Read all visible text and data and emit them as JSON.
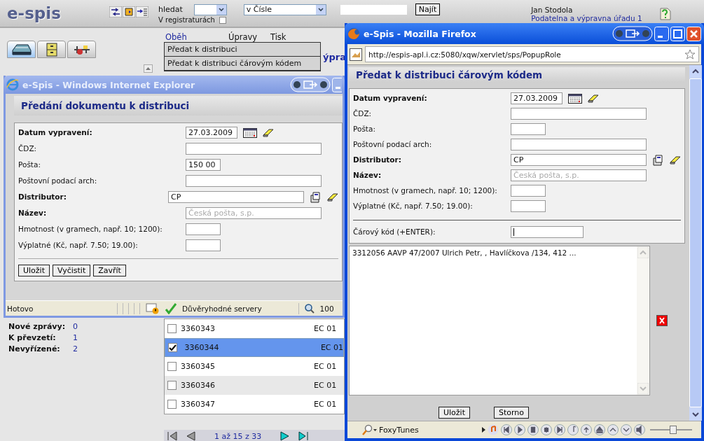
{
  "app": {
    "logo": "e-spis",
    "search_label": "hledat",
    "search_field": "v Čísle",
    "registry_label": "V registraturách",
    "registry_checked": false,
    "find_button": "Najít",
    "user_name": "Jan Stodola",
    "user_office": "Podatelna a výpravna úřadu 1",
    "nav_tabs": [
      {
        "selected": true
      },
      {
        "selected": false
      },
      {
        "selected": false
      }
    ],
    "menu": [
      {
        "label": "Oběh",
        "selected": true
      },
      {
        "label": "Úpravy",
        "selected": false
      },
      {
        "label": "Tisk",
        "selected": false
      }
    ],
    "menu_items": [
      "Předat k distribuci",
      "Předat k distribuci čárovým kódem"
    ],
    "heading_fragment": "ýpra",
    "stats": [
      {
        "label": "Nové zprávy:",
        "value": "0"
      },
      {
        "label": "K převzetí:",
        "value": "1"
      },
      {
        "label": "Nevyřízené:",
        "value": "2"
      }
    ],
    "rows": [
      {
        "number": "3360343",
        "column_2": "EC 01",
        "checked": false,
        "selected": false
      },
      {
        "number": "3360344",
        "column_2": "EC 01",
        "checked": true,
        "selected": true
      },
      {
        "number": "3360345",
        "column_2": "EC 01",
        "checked": false,
        "selected": false
      },
      {
        "number": "3360346",
        "column_2": "EC 01",
        "checked": false,
        "selected": false
      },
      {
        "number": "3360347",
        "column_2": "EC 01",
        "checked": false,
        "selected": false
      }
    ],
    "pager": "1 až 15 z 33"
  },
  "ie_window": {
    "title": "e-Spis - Windows Internet Explorer",
    "heading": "Předání dokumentu k distribuci",
    "fields": [
      {
        "label": "Datum vypravení:",
        "required": true,
        "kind": "date",
        "value": "27.03.2009"
      },
      {
        "label": "ČDZ:",
        "required": false,
        "kind": "wide"
      },
      {
        "label": "Pošta:",
        "required": false,
        "kind": "short",
        "value": "150 00"
      },
      {
        "label": "Poštovní podací arch:",
        "required": false,
        "kind": "wide"
      },
      {
        "label": "Distributor:",
        "required": true,
        "kind": "lookup",
        "value": "CP"
      },
      {
        "label": "Název:",
        "required": true,
        "kind": "readonly",
        "value": "Česká pošta, s.p."
      },
      {
        "label": "Hmotnost (v gramech, např. 10; 1200):",
        "required": false,
        "kind": "short"
      },
      {
        "label": "Výplatné (Kč, např. 7.50; 19.00):",
        "required": false,
        "kind": "short"
      }
    ],
    "buttons": [
      "Uložit",
      "Vyčistit",
      "Zavřít"
    ],
    "status": "Hotovo",
    "zone": "Důvěryhodné servery",
    "zoom": "100"
  },
  "firefox_window": {
    "title": "e-Spis - Mozilla Firefox",
    "url": "http://espis-apl.i.cz:5080/xqw/xervlet/sps/PopupRole",
    "heading": "Předat k distribuci čárovým kódem",
    "fields": [
      {
        "label": "Datum vypravení:",
        "required": true,
        "kind": "date",
        "value": "27.03.2009"
      },
      {
        "label": "ČDZ:",
        "required": false,
        "kind": "wide"
      },
      {
        "label": "Pošta:",
        "required": false,
        "kind": "short"
      },
      {
        "label": "Poštovní podací arch:",
        "required": false,
        "kind": "wide"
      },
      {
        "label": "Distributor:",
        "required": true,
        "kind": "lookup",
        "value": "CP"
      },
      {
        "label": "Název:",
        "required": true,
        "kind": "readonly",
        "value": "Česká pošta, s.p."
      },
      {
        "label": "Hmotnost (v gramech, např. 10; 1200):",
        "required": false,
        "kind": "short"
      },
      {
        "label": "Výplatné (Kč, např. 7.50; 19.00):",
        "required": false,
        "kind": "short"
      }
    ],
    "barcode": {
      "label": "Čárový kód (+ENTER):",
      "focused": true
    },
    "list_text": "3312056 AAVP 47/2007 Ulrich Petr, , Havlíčkova /134, 412 ...",
    "buttons": [
      "Uložit",
      "Storno"
    ],
    "status": "FoxyTunes",
    "volume": {
      "level": 0.55
    }
  }
}
